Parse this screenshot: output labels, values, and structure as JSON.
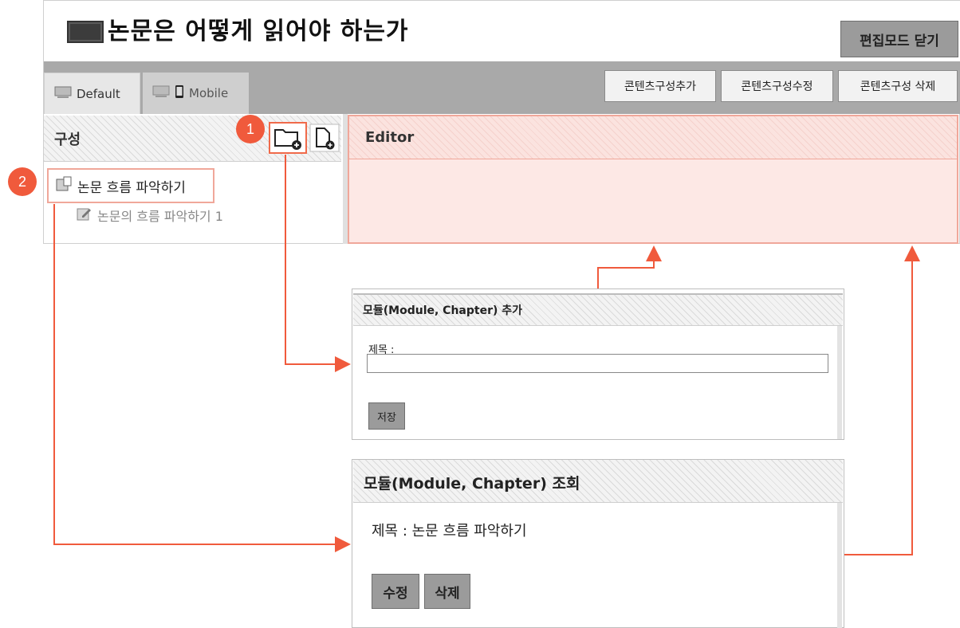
{
  "header": {
    "title": "논문은 어떻게 읽어야 하는가",
    "close_edit_mode": "편집모드 닫기"
  },
  "tabs": [
    {
      "label": "Default",
      "icon": "monitor-icon",
      "active": true
    },
    {
      "label": "Mobile",
      "icon": "monitor-mobile-icon",
      "active": false
    }
  ],
  "actions": {
    "add": "콘텐츠구성추가",
    "edit": "콘텐츠구성수정",
    "delete": "콘텐츠구성 삭제"
  },
  "structure": {
    "label": "구성",
    "add_folder_icon": "folder-add-icon",
    "add_file_icon": "file-add-icon",
    "tree": [
      {
        "label": "논문 흐름 파악하기",
        "type": "module",
        "children": [
          {
            "label": "논문의 흐름 파악하기 1",
            "type": "content"
          }
        ]
      }
    ]
  },
  "editor": {
    "label": "Editor"
  },
  "callouts": {
    "one": "1",
    "two": "2"
  },
  "add_dialog": {
    "title": "모듈(Module, Chapter) 추가",
    "field_label": "제목 :",
    "field_value": "",
    "save": "저장"
  },
  "view_dialog": {
    "title": "모듈(Module, Chapter) 조회",
    "field": "제목 : 논문 흐름 파악하기",
    "edit": "수정",
    "delete": "삭제"
  },
  "colors": {
    "accent": "#f05a3c",
    "highlight_border": "#f0a79a",
    "editor_bg": "#fde8e5",
    "tab_bar": "#a9a9a9",
    "button_gray": "#9b9b9b"
  }
}
